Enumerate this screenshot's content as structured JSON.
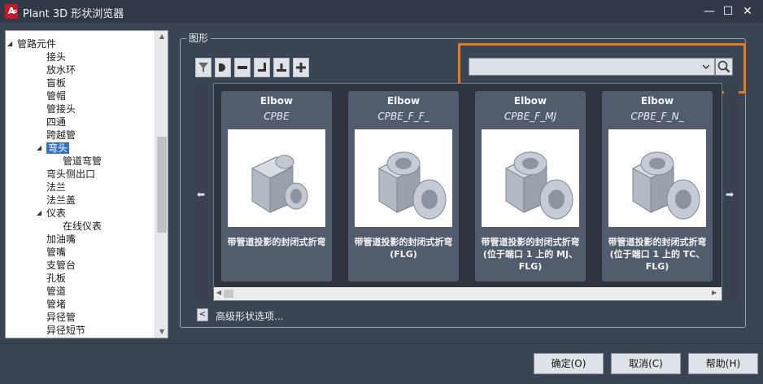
{
  "window": {
    "title": "Plant 3D 形状浏览器",
    "app_icon_letter": "A",
    "app_icon_sub": "3D",
    "minimize": "—",
    "maximize": "☐",
    "close": "✕"
  },
  "tree": {
    "items": [
      {
        "label": "管路元件",
        "level": 0,
        "expanded": true
      },
      {
        "label": "接头",
        "level": 1
      },
      {
        "label": "放水环",
        "level": 1
      },
      {
        "label": "盲板",
        "level": 1
      },
      {
        "label": "管帽",
        "level": 1
      },
      {
        "label": "管接头",
        "level": 1
      },
      {
        "label": "四通",
        "level": 1
      },
      {
        "label": "跨越管",
        "level": 1
      },
      {
        "label": "弯头",
        "level": 1,
        "expanded": true,
        "selected": true
      },
      {
        "label": "管道弯管",
        "level": 2
      },
      {
        "label": "弯头侧出口",
        "level": 1
      },
      {
        "label": "法兰",
        "level": 1
      },
      {
        "label": "法兰盖",
        "level": 1
      },
      {
        "label": "仪表",
        "level": 1,
        "expanded": true
      },
      {
        "label": "在线仪表",
        "level": 2
      },
      {
        "label": "加油嘴",
        "level": 1
      },
      {
        "label": "管嘴",
        "level": 1
      },
      {
        "label": "支管台",
        "level": 1
      },
      {
        "label": "孔板",
        "level": 1
      },
      {
        "label": "管道",
        "level": 1
      },
      {
        "label": "管堵",
        "level": 1
      },
      {
        "label": "异径管",
        "level": 1
      },
      {
        "label": "异径短节",
        "level": 1
      }
    ]
  },
  "group": {
    "label": "图形"
  },
  "search": {
    "value": "",
    "placeholder": ""
  },
  "gallery": {
    "left_arrow": "⬅",
    "right_arrow": "➡",
    "cards": [
      {
        "title": "Elbow",
        "subtitle": "CPBE",
        "description": "带管道投影的封闭式折弯",
        "flanged": false
      },
      {
        "title": "Elbow",
        "subtitle": "CPBE_F_F_",
        "description": "带管道投影的封闭式折弯 (FLG)",
        "flanged": true
      },
      {
        "title": "Elbow",
        "subtitle": "CPBE_F_MJ",
        "description": "带管道投影的封闭式折弯 (位于端口 1 上的 MJ、FLG)",
        "flanged": true
      },
      {
        "title": "Elbow",
        "subtitle": "CPBE_F_N_",
        "description": "带管道投影的封闭式折弯 (位于端口 1 上的 TC、FLG)",
        "flanged": true
      }
    ]
  },
  "advanced": {
    "button": "<",
    "label": "高级形状选项..."
  },
  "buttons": {
    "ok": "确定(O)",
    "cancel": "取消(C)",
    "help": "帮助(H)"
  },
  "colors": {
    "highlight": "#e37a23",
    "selection": "#3172c6",
    "background": "#3b4453"
  }
}
